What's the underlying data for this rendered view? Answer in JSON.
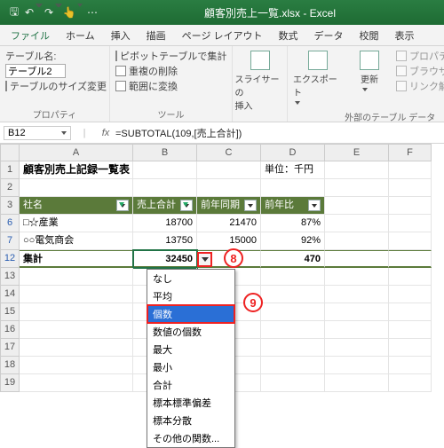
{
  "window": {
    "title": "顧客別売上一覧.xlsx  -  Excel"
  },
  "menu": [
    "ファイル",
    "ホーム",
    "挿入",
    "描画",
    "ページ レイアウト",
    "数式",
    "データ",
    "校閲",
    "表示"
  ],
  "ribbon": {
    "properties": {
      "label": "プロパティ",
      "table_name_label": "テーブル名:",
      "table_name": "テーブル2",
      "resize": "テーブルのサイズ変更"
    },
    "tools": {
      "label": "ツール",
      "pivot": "ピボットテーブルで集計",
      "dedup": "重複の削除",
      "torange": "範囲に変換"
    },
    "slicer": {
      "top": "スライサーの",
      "bottom": "挿入"
    },
    "external": {
      "label": "外部のテーブル データ",
      "export": "エクスポート",
      "refresh": "更新",
      "p1": "プロパティ",
      "p2": "ブラウザーで開く",
      "p3": "リンク解除"
    }
  },
  "formula_bar": {
    "cell_ref": "B12",
    "formula": "=SUBTOTAL(109,[売上合計])"
  },
  "columns": [
    "A",
    "B",
    "C",
    "D",
    "E",
    "F"
  ],
  "row_headers": [
    "1",
    "2",
    "3",
    "6",
    "7",
    "12",
    "13",
    "14",
    "15",
    "16",
    "17",
    "18",
    "19"
  ],
  "sheet": {
    "title": "顧客別売上記録一覧表",
    "unit": "単位：千円",
    "headers": [
      "社名",
      "売上合計",
      "前年同期",
      "前年比"
    ],
    "rows": [
      {
        "name": "□☆産業",
        "total": "18700",
        "prev": "21470",
        "ratio": "87%"
      },
      {
        "name": "○○電気商会",
        "total": "13750",
        "prev": "15000",
        "ratio": "92%"
      }
    ],
    "totals": {
      "label": "集計",
      "total": "32450",
      "prev_tail": "470"
    }
  },
  "dropdown": {
    "items": [
      "なし",
      "平均",
      "個数",
      "数値の個数",
      "最大",
      "最小",
      "合計",
      "標本標準偏差",
      "標本分散",
      "その他の関数..."
    ],
    "hl": 2
  },
  "callouts": {
    "c8": "8",
    "c9": "9"
  }
}
